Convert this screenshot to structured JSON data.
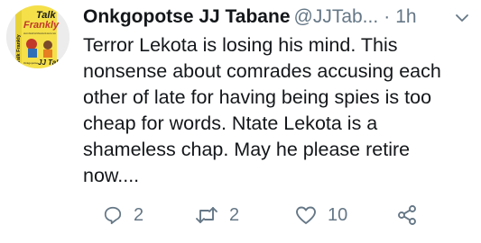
{
  "tweet": {
    "author_name": "Onkgopotse JJ Tabane",
    "handle": "@JJTab...",
    "separator": "·",
    "time": "1h",
    "text": "Terror Lekota is losing his mind. This nonsense about comrades accusing each other of late for having being spies is too cheap for words. Ntate Lekota is a shameless chap. May he please retire now....",
    "avatar": {
      "title_line1": "Talk",
      "title_line2": "Frankly",
      "tagline": "Letters to influential South Africans about the state of our nation",
      "side_text": "Talk Frankly",
      "author_credit": "JJ Tabane",
      "author_prefix": "Onkgopotse"
    }
  },
  "actions": {
    "reply_count": "2",
    "retweet_count": "2",
    "like_count": "10"
  },
  "icons": [
    "reply-icon",
    "retweet-icon",
    "like-icon",
    "share-icon",
    "chevron-down-icon"
  ],
  "colors": {
    "icon": "#657786",
    "text": "#14171a",
    "avatar_bg": "#f5e04a"
  }
}
